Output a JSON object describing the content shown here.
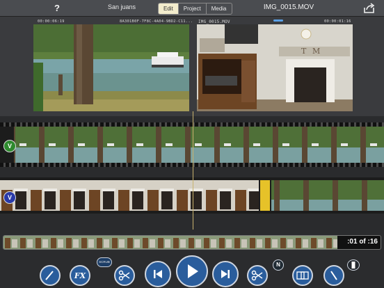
{
  "topbar": {
    "help_label": "?",
    "project_name": "San juans",
    "tabs": [
      {
        "label": "Edit",
        "active": true
      },
      {
        "label": "Project",
        "active": false
      },
      {
        "label": "Media",
        "active": false
      }
    ],
    "file_title": "IMG_0015.MOV",
    "share_icon": "share-icon"
  },
  "viewer": {
    "left_timecode": "00:00:06:19",
    "left_clip_name": "8A301B0F-7F8C-4A04-9BD2-C11...",
    "right_clip_name": "IMG_0015.MOV",
    "right_timecode": "00:00:01:16"
  },
  "tracks": {
    "video_label": "V",
    "video2_label": "V"
  },
  "scrub_strip": {
    "count": ":01 of :16"
  },
  "controls": {
    "draw_icon": "pencil-icon",
    "fx_label": "FX",
    "scrub_label": "SCRUB",
    "cut_icon": "scissors-icon",
    "prev_icon": "skip-back-icon",
    "play_icon": "play-icon",
    "next_icon": "skip-forward-icon",
    "split_icon": "scissors-icon",
    "n_label": "N",
    "transition_icon": "transition-icon",
    "trim_icon": "slash-icon"
  },
  "colors": {
    "accent": "#2a5d9c",
    "edit_tab": "#f2eccc",
    "video_track": "#2e8a2e",
    "video2_track": "#2a3aa8"
  }
}
